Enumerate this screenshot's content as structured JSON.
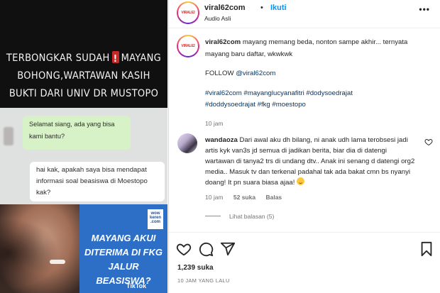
{
  "media": {
    "headline_line1a": "TERBONGKAR SUDAH",
    "headline_line1b": "MAYANG",
    "headline_line2": "BOHONG,WARTAWAN KASIH",
    "headline_line3": "BUKTI DARI UNIV DR MUSTOPO",
    "chat_bubble_1": "Selamat siang, ada yang bisa kami bantu?",
    "chat_bubble_2": "hai kak, apakah saya bisa mendapat informasi soal beasiswa di Moestopo kak?",
    "photo_logo": "wow keren .com",
    "photo_caption": "MAYANG AKUI DITERIMA DI FKG JALUR BEASISWA?",
    "photo_watermark": "TikTok"
  },
  "post": {
    "avatar_text": "VIRAL62",
    "username": "viral62com",
    "dot": "•",
    "follow_label": "Ikuti",
    "audio": "Audio Asli",
    "more_label": "•••",
    "caption": {
      "username": "viral62com",
      "text": "mayang memang beda, nonton sampe akhir... ternyata mayang baru daftar, wkwkwk",
      "follow_prefix": "FOLLOW",
      "follow_mention": "@viral62com",
      "hashtags_line1": "#viral62com #mayanglucyanafitri #dodysoedrajat",
      "hashtags_line2": "#doddysoedrajat #fkg #moestopo",
      "time": "10 jam"
    },
    "comment": {
      "username": "wandaoza",
      "text": "Dari awal aku dh bilang, ni anak udh lama terobsesi jadi artis kyk van3s jd semua di jadikan berita, biar dia di datengi wartawan di tanya2 trs di undang dtv.. Anak ini senang d datengi org2 media.. Masuk tv dan terkenal padahal tak ada bakat cmn bs nyanyi doang! It pn suara biasa ajaa!",
      "time": "10 jam",
      "likes": "52 suka",
      "reply_label": "Balas",
      "view_replies": "Lihat balasan (5)"
    },
    "likes": "1,239 suka",
    "ago": "10 JAM YANG LALU"
  }
}
